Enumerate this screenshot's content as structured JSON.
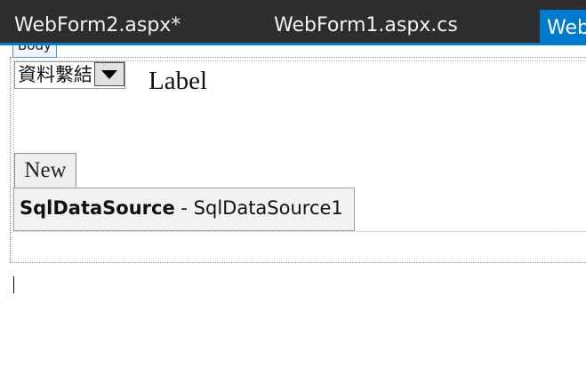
{
  "tabs": [
    {
      "label": "WebForm2.aspx*",
      "active": false
    },
    {
      "label": "WebForm1.aspx.cs",
      "active": false
    },
    {
      "label": "Web",
      "active": true
    }
  ],
  "colors": {
    "tabbar_bg": "#2d2d30",
    "accent": "#007acc",
    "body_tag_border": "#5b8fc7"
  },
  "designer": {
    "body_tag": "Body",
    "dropdown": {
      "selected": "資料繫結"
    },
    "label_text": "Label",
    "new_button": "New",
    "sql_data_source": {
      "type": "SqlDataSource",
      "separator": " - ",
      "id": "SqlDataSource1"
    }
  }
}
